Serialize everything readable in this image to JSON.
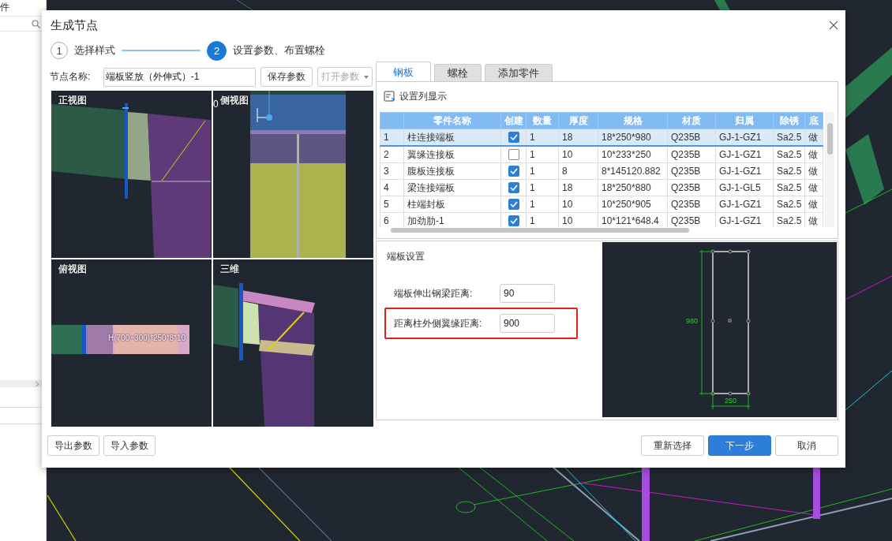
{
  "sidebar": {
    "title": "件"
  },
  "dialog": {
    "title": "生成节点",
    "steps": [
      {
        "number": "1",
        "label": "选择样式",
        "selected": false
      },
      {
        "number": "2",
        "label": "设置参数、布置螺栓",
        "selected": true
      }
    ],
    "node_name": {
      "label": "节点名称:",
      "value": "端板竖放（外伸式）-1"
    },
    "save_button": "保存参数",
    "open_button": {
      "label": "打开参数",
      "disabled": true
    },
    "views": [
      {
        "label": "正视图",
        "kind": "front"
      },
      {
        "label": "侧视图",
        "kind": "side",
        "dimension": "0"
      },
      {
        "label": "俯视图",
        "kind": "top",
        "section": "H(700~300)*250*8*10"
      },
      {
        "label": "三维",
        "kind": "iso"
      }
    ],
    "tabs": [
      {
        "label": "钢板",
        "selected": true
      },
      {
        "label": "螺栓",
        "selected": false
      },
      {
        "label": "添加零件",
        "selected": false
      }
    ],
    "column_settings": "设置列显示",
    "table": {
      "columns": [
        "",
        "零件名称",
        "创建",
        "数量",
        "厚度",
        "规格",
        "材质",
        "归属",
        "除锈",
        "底"
      ],
      "rows": [
        {
          "cells": [
            "1",
            "柱连接端板",
            "",
            "1",
            "18",
            "18*250*980",
            "Q235B",
            "GJ-1-GZ1",
            "Sa2.5",
            "做"
          ],
          "checked": true,
          "selected": true
        },
        {
          "cells": [
            "2",
            "翼缘连接板",
            "",
            "1",
            "10",
            "10*233*250",
            "Q235B",
            "GJ-1-GZ1",
            "Sa2.5",
            "做"
          ],
          "checked": false,
          "selected": false
        },
        {
          "cells": [
            "3",
            "腹板连接板",
            "",
            "1",
            "8",
            "8*145120.882",
            "Q235B",
            "GJ-1-GZ1",
            "Sa2.5",
            "做"
          ],
          "checked": true,
          "selected": false
        },
        {
          "cells": [
            "4",
            "梁连接端板",
            "",
            "1",
            "18",
            "18*250*880",
            "Q235B",
            "GJ-1-GL5",
            "Sa2.5",
            "做"
          ],
          "checked": true,
          "selected": false
        },
        {
          "cells": [
            "5",
            "柱端封板",
            "",
            "1",
            "10",
            "10*250*905",
            "Q235B",
            "GJ-1-GZ1",
            "Sa2.5",
            "做"
          ],
          "checked": true,
          "selected": false
        },
        {
          "cells": [
            "6",
            "加劲肋-1",
            "",
            "1",
            "10",
            "10*121*648.4",
            "Q235B",
            "GJ-1-GZ1",
            "Sa2.5",
            "做"
          ],
          "checked": true,
          "selected": false
        }
      ]
    },
    "settings": {
      "title": "端板设置",
      "fields": [
        {
          "label": "端板伸出钢梁距离:",
          "value": "90",
          "highlighted": false
        },
        {
          "label": "距离柱外侧翼缘距离:",
          "value": "900",
          "highlighted": true
        }
      ]
    },
    "preview": {
      "height_label": "980",
      "width_label": "250"
    },
    "footer_left": [
      "导出参数",
      "导入参数"
    ],
    "footer_right": [
      {
        "label": "重新选择",
        "kind": "default"
      },
      {
        "label": "下一步",
        "kind": "primary"
      },
      {
        "label": "取消",
        "kind": "default"
      }
    ]
  }
}
